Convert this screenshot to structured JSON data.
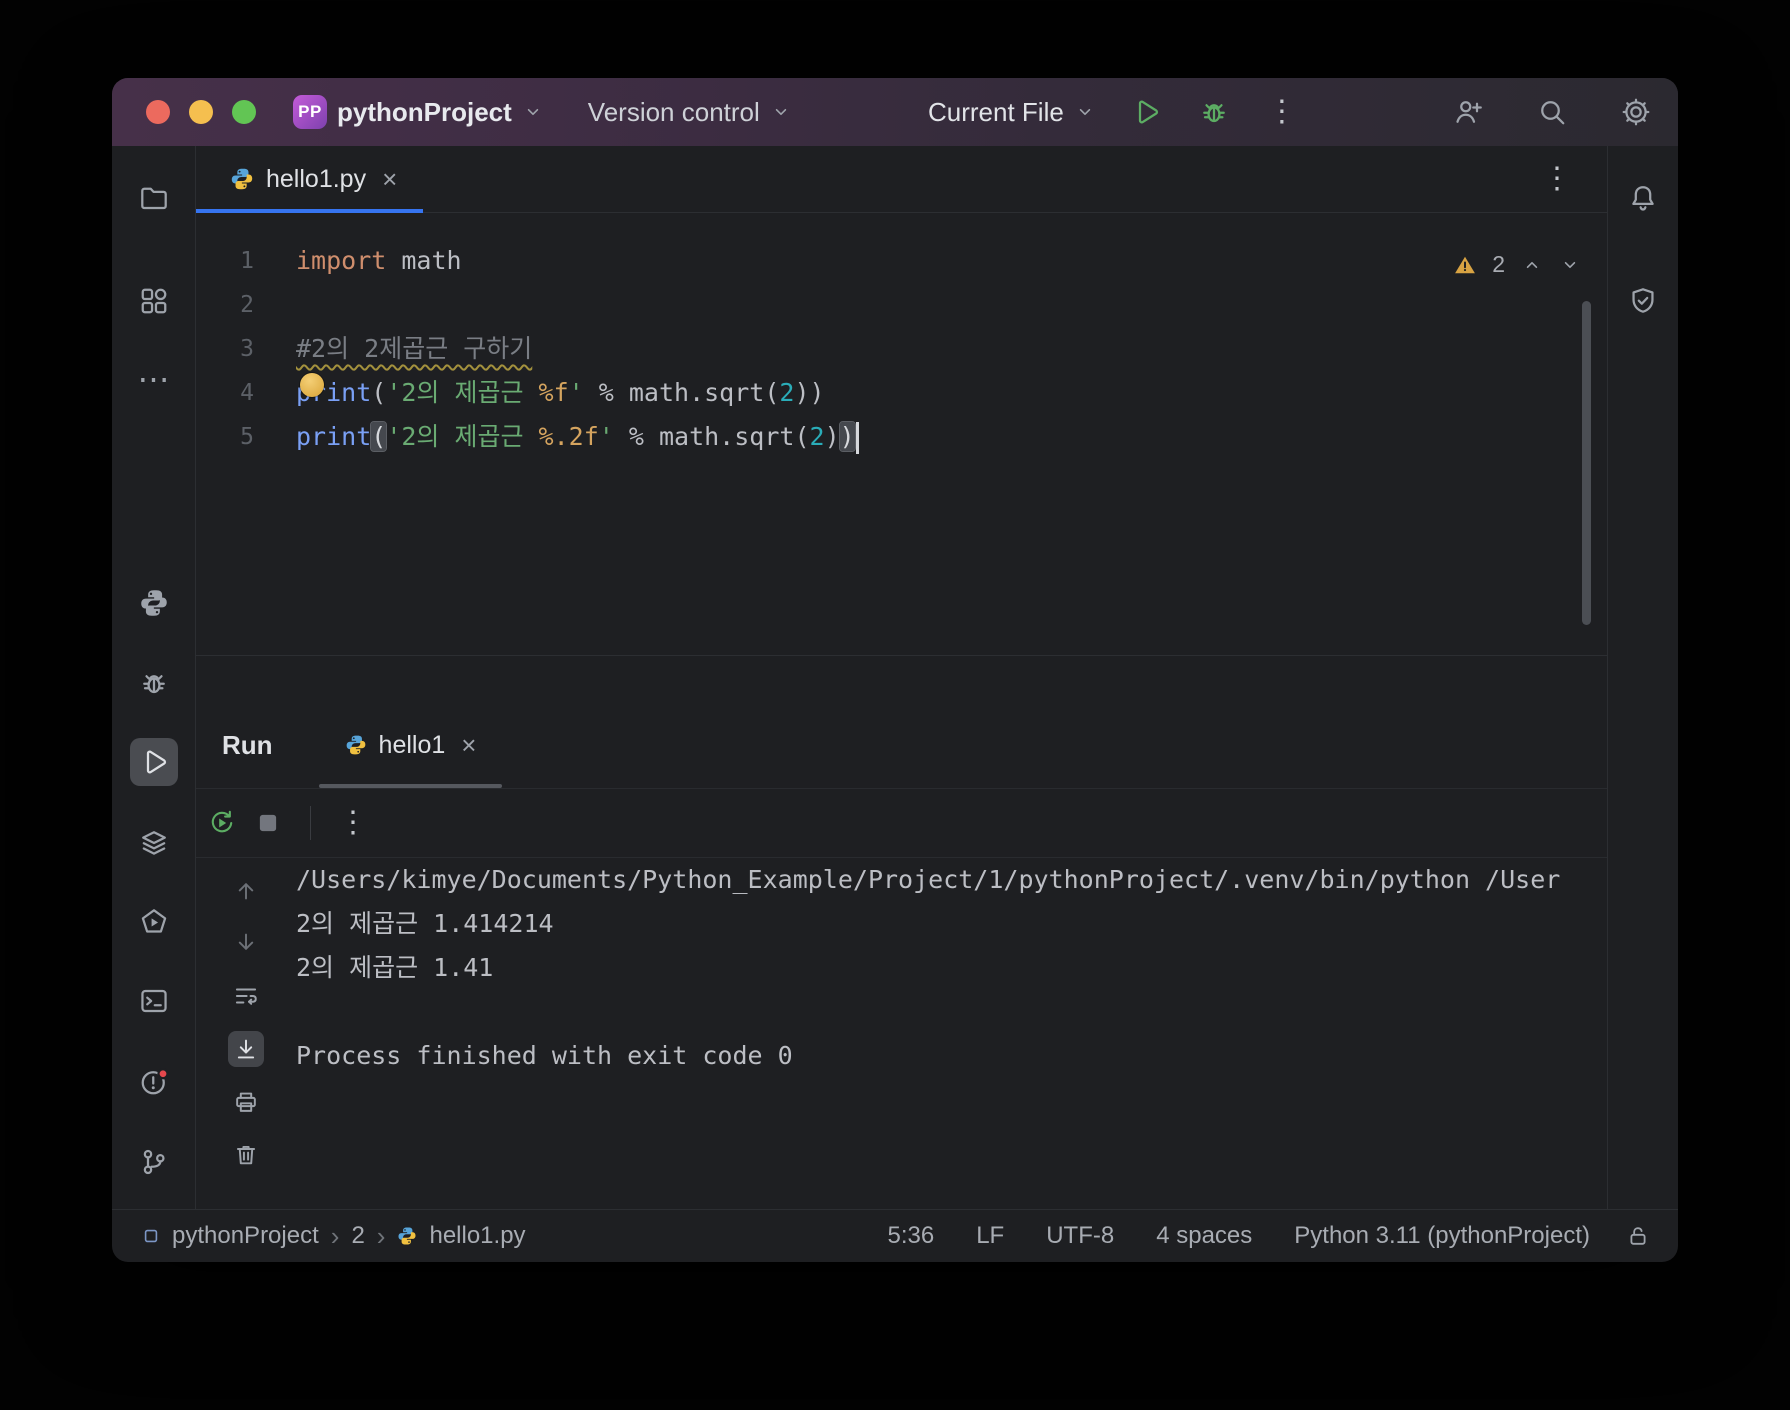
{
  "titlebar": {
    "project_badge": "PP",
    "project_name": "pythonProject",
    "version_control_label": "Version control",
    "run_config_label": "Current File"
  },
  "glyphs": {
    "close": "×",
    "kebab": "⋮",
    "more_h": "⋯",
    "crumb_sep": "›"
  },
  "editor_tabs": {
    "active_tab": "hello1.py"
  },
  "editor": {
    "warning_count": "2",
    "code_lines": [
      {
        "num": "1",
        "segments": [
          {
            "c": "kw",
            "t": "import"
          },
          {
            "c": "plain",
            "t": " math"
          }
        ]
      },
      {
        "num": "2",
        "segments": []
      },
      {
        "num": "3",
        "segments": [
          {
            "c": "comment typo",
            "t": "#2의 2제곱근 구하기"
          }
        ]
      },
      {
        "num": "4",
        "bulb": true,
        "segments": [
          {
            "c": "builtin",
            "t": "print"
          },
          {
            "c": "plain",
            "t": "("
          },
          {
            "c": "str",
            "t": "'2의 제곱근 "
          },
          {
            "c": "fmt",
            "t": "%f"
          },
          {
            "c": "str",
            "t": "'"
          },
          {
            "c": "plain",
            "t": " % math.sqrt("
          },
          {
            "c": "num",
            "t": "2"
          },
          {
            "c": "plain",
            "t": "))"
          }
        ]
      },
      {
        "num": "5",
        "caret": true,
        "segments": [
          {
            "c": "builtin",
            "t": "print"
          },
          {
            "c": "hl",
            "t": "("
          },
          {
            "c": "str",
            "t": "'2의 제곱근 "
          },
          {
            "c": "fmt",
            "t": "%.2f"
          },
          {
            "c": "str",
            "t": "'"
          },
          {
            "c": "plain",
            "t": " % math.sqrt("
          },
          {
            "c": "num",
            "t": "2"
          },
          {
            "c": "plain",
            "t": ")"
          },
          {
            "c": "hl",
            "t": ")"
          }
        ]
      }
    ]
  },
  "run_panel": {
    "header_label": "Run",
    "tab_label": "hello1",
    "console_lines": [
      "/Users/kimye/Documents/Python_Example/Project/1/pythonProject/.venv/bin/python /User",
      "2의 제곱근 1.414214",
      "2의 제곱근 1.41",
      "",
      "Process finished with exit code 0"
    ]
  },
  "status_bar": {
    "crumbs": [
      "pythonProject",
      "2",
      "hello1.py"
    ],
    "cursor_position": "5:36",
    "line_separator": "LF",
    "encoding": "UTF-8",
    "indent": "4 spaces",
    "interpreter": "Python 3.11 (pythonProject)"
  },
  "colors": {
    "accent": "#3674f0",
    "keyword": "#cf8e6d",
    "string": "#6aab73",
    "number": "#2aacb8",
    "builtin": "#7aa0f5",
    "comment": "#7a7e85",
    "format_spec": "#d5a45f",
    "run_green": "#5cad63",
    "warning_yellow": "#d8a343",
    "error_red": "#e5484d"
  }
}
